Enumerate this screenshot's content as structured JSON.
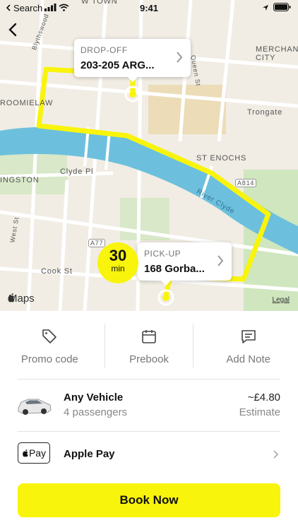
{
  "status_bar": {
    "carrier": "Search",
    "time": "9:41"
  },
  "nav": {
    "back_icon": "chevron-left-icon"
  },
  "map": {
    "labels": [
      "MERCHANT CITY",
      "ROOMIELAW",
      "Trongate",
      "ST ENOCHS",
      "Clyde Pl",
      "INGSTON",
      "River Clyde",
      "A814",
      "A77",
      "Cook St",
      "West St",
      "Queen St",
      "Blythswood",
      "W TOWN"
    ],
    "attribution": "Maps",
    "legal": "Legal",
    "route_color": "#f9f40b"
  },
  "dropoff": {
    "label": "DROP-OFF",
    "address": "203-205 ARG..."
  },
  "pickup": {
    "label": "PICK-UP",
    "address": "168 Gorba..."
  },
  "eta": {
    "value": "30",
    "unit": "min"
  },
  "actions": [
    {
      "label": "Promo code",
      "icon": "tag-icon"
    },
    {
      "label": "Prebook",
      "icon": "calendar-icon"
    },
    {
      "label": "Add Note",
      "icon": "message-icon"
    }
  ],
  "vehicle": {
    "name": "Any Vehicle",
    "passengers": "4 passengers",
    "price": "~£4.80",
    "price_note": "Estimate"
  },
  "payment": {
    "method_badge": "Pay",
    "method_name": "Apple Pay"
  },
  "book_button": {
    "label": "Book Now"
  },
  "colors": {
    "accent": "#f9f40b",
    "river": "#6cc0dd"
  }
}
